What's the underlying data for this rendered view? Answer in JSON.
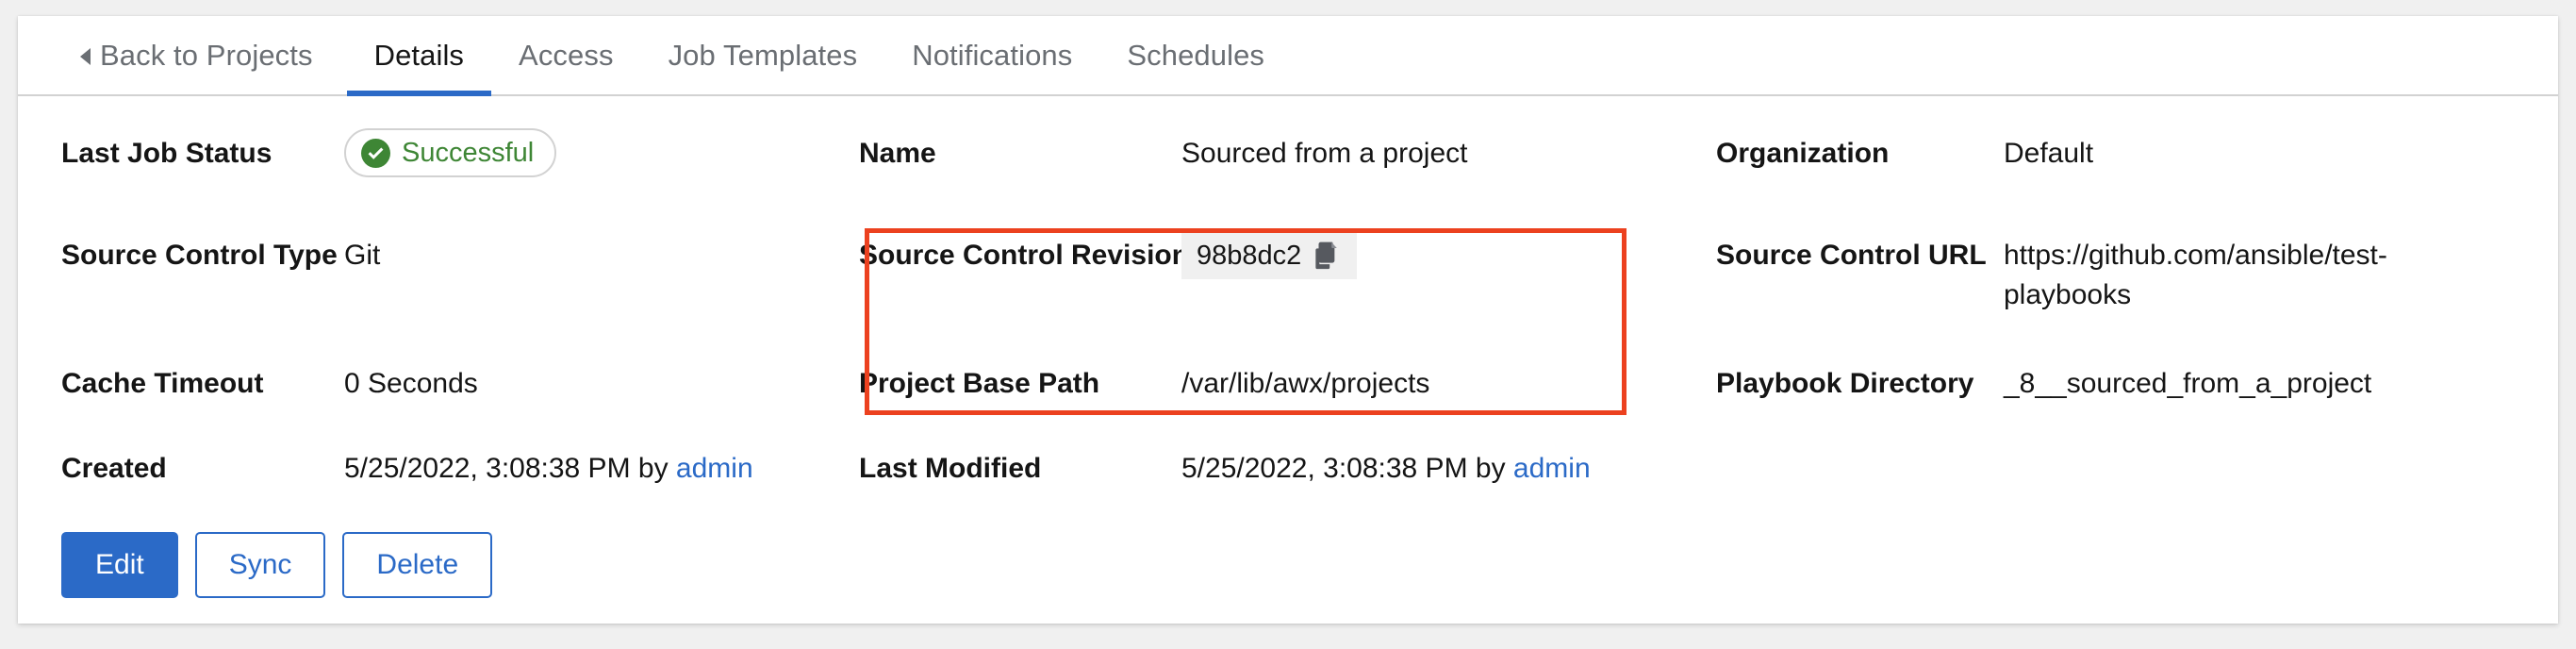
{
  "tabs": [
    {
      "label": "Back to Projects",
      "name": "back-to-projects",
      "active": false,
      "caret": true
    },
    {
      "label": "Details",
      "name": "details",
      "active": true
    },
    {
      "label": "Access",
      "name": "access",
      "active": false
    },
    {
      "label": "Job Templates",
      "name": "job-templates",
      "active": false
    },
    {
      "label": "Notifications",
      "name": "notifications",
      "active": false
    },
    {
      "label": "Schedules",
      "name": "schedules",
      "active": false
    }
  ],
  "details": {
    "last_job_status": {
      "label": "Last Job Status",
      "value": "Successful",
      "icon": "check-circle-icon",
      "color": "#3e8635"
    },
    "source_control_type": {
      "label": "Source Control Type",
      "value": "Git"
    },
    "cache_timeout": {
      "label": "Cache Timeout",
      "value": "0 Seconds"
    },
    "created": {
      "label": "Created",
      "value": "5/25/2022, 3:08:38 PM by ",
      "user": "admin"
    },
    "name": {
      "label": "Name",
      "value": "Sourced from a project"
    },
    "source_control_revision": {
      "label": "Source Control Revision",
      "value": "98b8dc2",
      "copy_icon": "copy-icon"
    },
    "project_base_path": {
      "label": "Project Base Path",
      "value": "/var/lib/awx/projects"
    },
    "last_modified": {
      "label": "Last Modified",
      "value": "5/25/2022, 3:08:38 PM by ",
      "user": "admin"
    },
    "organization": {
      "label": "Organization",
      "value": "Default"
    },
    "source_control_url": {
      "label": "Source Control URL",
      "value": "https://github.com/ansible/test-playbooks"
    },
    "playbook_directory": {
      "label": "Playbook Directory",
      "value": "_8__sourced_from_a_project"
    }
  },
  "actions": [
    {
      "label": "Edit",
      "name": "edit-button",
      "style": "primary"
    },
    {
      "label": "Sync",
      "name": "sync-button",
      "style": "secondary"
    },
    {
      "label": "Delete",
      "name": "delete-button",
      "style": "secondary"
    }
  ],
  "annotation": {
    "highlight_color": "#ec411f"
  },
  "colors": {
    "accent": "#2b6ac7",
    "success": "#3e8635",
    "link": "#2b6ac7",
    "page_bg": "#f0f0f0",
    "card_bg": "#ffffff"
  }
}
